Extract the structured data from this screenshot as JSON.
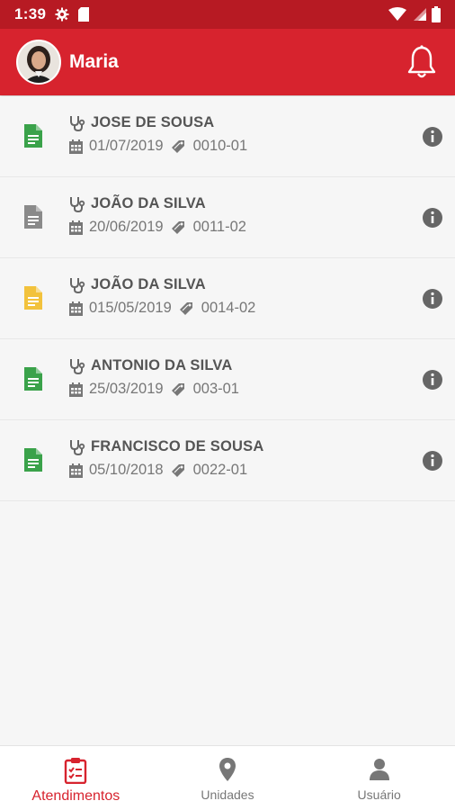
{
  "status_bar": {
    "time": "1:39"
  },
  "header": {
    "user_name": "Maria"
  },
  "items": [
    {
      "patient": "JOSE DE SOUSA",
      "date": "01/07/2019",
      "code": "0010-01",
      "doc_color": "#3aa24a"
    },
    {
      "patient": "JOÃO DA SILVA",
      "date": "20/06/2019",
      "code": "0011-02",
      "doc_color": "#8a8a8a"
    },
    {
      "patient": "JOÃO DA SILVA",
      "date": "015/05/2019",
      "code": "0014-02",
      "doc_color": "#f2c23c"
    },
    {
      "patient": "ANTONIO DA SILVA",
      "date": "25/03/2019",
      "code": "003-01",
      "doc_color": "#3aa24a"
    },
    {
      "patient": "FRANCISCO DE SOUSA",
      "date": "05/10/2018",
      "code": "0022-01",
      "doc_color": "#3aa24a"
    }
  ],
  "bottom_nav": [
    {
      "label": "Atendimentos",
      "icon": "clipboard-icon",
      "active": true
    },
    {
      "label": "Unidades",
      "icon": "location-pin-icon",
      "active": false
    },
    {
      "label": "Usuário",
      "icon": "person-icon",
      "active": false
    }
  ],
  "colors": {
    "primary": "#d7232e",
    "status_bar": "#b71a23"
  }
}
